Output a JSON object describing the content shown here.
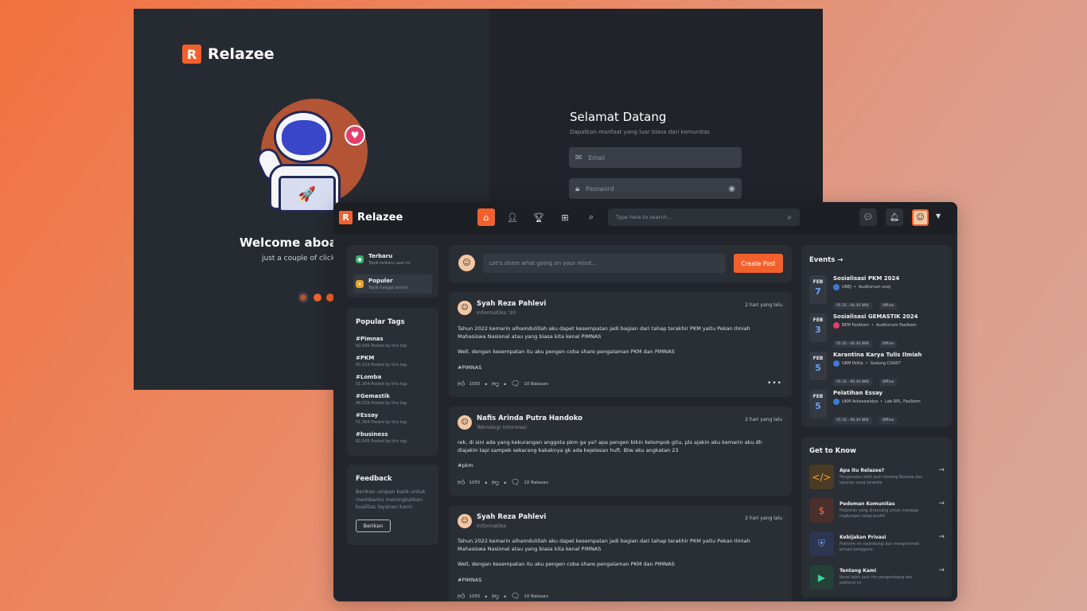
{
  "brand": {
    "name": "Relazee",
    "logo_letter": "R",
    "accent": "#f2612d"
  },
  "login": {
    "welcome_title": "Welcome aboard",
    "welcome_sub": "just a couple of clicks a",
    "form_title": "Selamat Datang",
    "form_sub": "Dapatkan manfaat yang luar biasa dari komunitas",
    "email_placeholder": "Email",
    "password_placeholder": "Password",
    "carousel_active_index": 0,
    "carousel_count": 3
  },
  "topbar": {
    "nav": [
      {
        "name": "home",
        "icon": "home-icon",
        "active": true
      },
      {
        "name": "people",
        "icon": "user-search-icon",
        "active": false
      },
      {
        "name": "trophy",
        "icon": "trophy-icon",
        "active": false
      },
      {
        "name": "post-add",
        "icon": "post-add-icon",
        "active": false
      },
      {
        "name": "search-doc",
        "icon": "document-search-icon",
        "active": false
      }
    ],
    "search_placeholder": "Type here to search..."
  },
  "sidebar": {
    "menu": [
      {
        "title": "Terbaru",
        "sub": "Topik terbaru saat ini",
        "icon": "new-badge-icon"
      },
      {
        "title": "Populer",
        "sub": "Topik hangat terkini",
        "icon": "fire-icon"
      }
    ],
    "popular_tags_title": "Popular Tags",
    "tags": [
      {
        "name": "#Pimnas",
        "count": "82,645 Posted by this tag"
      },
      {
        "name": "#PKM",
        "count": "65,523 Posted by this tag"
      },
      {
        "name": "#Lomba",
        "count": "51,354 Posted by this tag"
      },
      {
        "name": "#Gemastik",
        "count": "48,029 Posted by this tag"
      },
      {
        "name": "#Essay",
        "count": "51,354 Posted by this tag"
      },
      {
        "name": "#business",
        "count": "82,645 Posted by this tag"
      }
    ],
    "feedback": {
      "title": "Feedback",
      "text": "Berikan umpan balik untuk membantu meningkatkan kualitas layanan kami",
      "button": "Berikan"
    }
  },
  "feed": {
    "share_placeholder": "Let's share what going on your mind...",
    "create_button": "Create Post",
    "posts": [
      {
        "name": "Syah Reza Pahlevi",
        "dept": "Informatika '20",
        "time": "2 hari yang lalu",
        "p1": "Tahun 2022 kemarin alhamdulillah aku dapet kesempatan jadi bagian dari tahap terakhir PKM yaitu Pekan Ilmiah Mahasiswa Nasional atau yang biasa kita kenal PIMNAS",
        "p2": "Well, dengan kesempatan itu aku pengen coba share pengalaman PKM dan PIMNAS",
        "tag": "#PIMNAS",
        "likes": "1055",
        "replies": "10 Balasan"
      },
      {
        "name": "Nafis Arinda Putra Handoko",
        "dept": "Teknologi Informasi",
        "time": "2 hari yang lalu",
        "p1": "rek, di sini ada yang kekurangan anggota pkm ga ya? apa pengen bikin kelompok gitu, pls ajakin aku kemarin aku dh diajakin tapi sampek sekarang kakaknya gk ada kejelasan huft. Btw aku angkatan 23",
        "tag": "#pkm",
        "likes": "1055",
        "replies": "10 Balasan"
      },
      {
        "name": "Syah Reza Pahlevi",
        "dept": "Informatika",
        "time": "2 hari yang lalu",
        "p1": "Tahun 2022 kemarin alhamdulillah aku dapet kesempatan jadi bagian dari tahap terakhir PKM yaitu Pekan Ilmiah Mahasiswa Nasional atau yang biasa kita kenal PIMNAS",
        "p2": "Well, dengan kesempatan itu aku pengen coba share pengalaman PKM dan PIMNAS",
        "tag": "#PIMNAS",
        "likes": "1055",
        "replies": "10 Balasan"
      }
    ]
  },
  "events": {
    "title": "Events",
    "items": [
      {
        "month": "FEB",
        "day": "7",
        "title": "Sosialisasi PKM 2024",
        "org": "UNEJ",
        "place": "Auditorium unej",
        "time": "05.35 - 06.30 WIB",
        "mode": "Offline",
        "org_color": "#3a7bd5"
      },
      {
        "month": "FEB",
        "day": "3",
        "title": "Sosialisasi GEMASTIK 2024",
        "org": "BEM Fasilkom",
        "place": "Auditorium Fasilkom",
        "time": "05.35 - 06.30 WIB",
        "mode": "Offline",
        "org_color": "#e63d6d"
      },
      {
        "month": "FEB",
        "day": "5",
        "title": "Karantina Karya Tulis Ilmiah",
        "org": "UKM Pelita",
        "place": "Gedung CDAST",
        "time": "05.35 - 06.30 WIB",
        "mode": "Offline",
        "org_color": "#3a7bd5"
      },
      {
        "month": "FEB",
        "day": "5",
        "title": "Pelatihan Essay",
        "org": "UKM Ackasewidya",
        "place": "Lab RPL, Fasilkom",
        "time": "05.35 - 06.30 WIB",
        "mode": "Offline",
        "org_color": "#3a7bd5"
      }
    ]
  },
  "get_to_know": {
    "title": "Get to Know",
    "items": [
      {
        "title": "Apa itu Relazee?",
        "desc": "Pengenalan lebih jauh tentang Relazee dan layanan yang tersedia",
        "icon": "code-icon",
        "bg": "#4a3b24",
        "fg": "#f2a33a"
      },
      {
        "title": "Pedoman Komunitas",
        "desc": "Pedoman yang dirancang untuk menjaga lingkungan tetap positif.",
        "icon": "dollar-coin-icon",
        "bg": "#4a2f2a",
        "fg": "#f26d4a"
      },
      {
        "title": "Kebijakan Privasi",
        "desc": "Platform ini melindungi dan menghormati privasi pengguna",
        "icon": "shield-icon",
        "bg": "#2c3650",
        "fg": "#6f98f0"
      },
      {
        "title": "Tentang Kami",
        "desc": "Kenal lebih jauh tim pengembang dan platform ini",
        "icon": "play-icon",
        "bg": "#244037",
        "fg": "#3fd09a"
      }
    ]
  }
}
